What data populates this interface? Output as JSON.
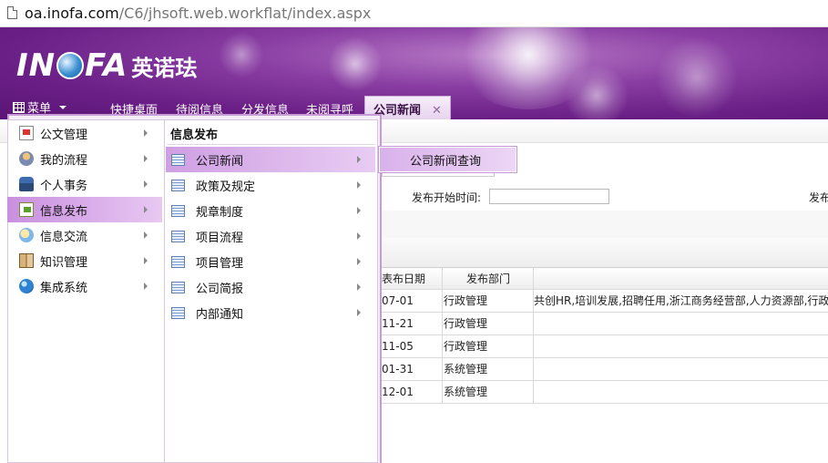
{
  "browser": {
    "url_host": "oa.inofa.com",
    "url_path": "/C6/jhsoft.web.workflat/index.aspx"
  },
  "header": {
    "logo_text_left": "IN",
    "logo_text_right": "FA",
    "logo_cn": "英诺珐",
    "menu_label": "菜单",
    "tabs": [
      {
        "label": "快捷桌面"
      },
      {
        "label": "待阅信息"
      },
      {
        "label": "分发信息"
      },
      {
        "label": "未阅寻呼"
      },
      {
        "label": "公司新闻",
        "close": "✕",
        "active": true
      }
    ]
  },
  "main_menu": {
    "items": [
      {
        "label": "公文管理",
        "icon": "document-icon"
      },
      {
        "label": "我的流程",
        "icon": "flow-icon"
      },
      {
        "label": "个人事务",
        "icon": "person-icon"
      },
      {
        "label": "信息发布",
        "icon": "publish-icon",
        "selected": true
      },
      {
        "label": "信息交流",
        "icon": "chat-icon"
      },
      {
        "label": "知识管理",
        "icon": "book-icon"
      },
      {
        "label": "集成系统",
        "icon": "globe-icon"
      }
    ]
  },
  "submenu": {
    "heading": "信息发布",
    "items": [
      {
        "label": "公司新闻",
        "selected": true
      },
      {
        "label": "政策及规定"
      },
      {
        "label": "规章制度"
      },
      {
        "label": "项目流程"
      },
      {
        "label": "项目管理"
      },
      {
        "label": "公司简报"
      },
      {
        "label": "内部通知"
      }
    ]
  },
  "submenu3": {
    "items": [
      {
        "label": "公司新闻查询"
      }
    ]
  },
  "background_page": {
    "publish_start_label": "发布开始时间:",
    "right_label_fragment": "发布",
    "table": {
      "headers": [
        "发布日期",
        "发布部门",
        ""
      ],
      "header_visible": [
        "表布日期",
        "发布部门",
        ""
      ],
      "rows": [
        [
          "07-01",
          "行政管理",
          "共创HR,培训发展,招聘任用,浙江商务经营部,人力资源部,行政"
        ],
        [
          "11-21",
          "行政管理",
          ""
        ],
        [
          "11-05",
          "行政管理",
          ""
        ],
        [
          "01-31",
          "系统管理",
          ""
        ],
        [
          "12-01",
          "系统管理",
          ""
        ]
      ]
    }
  },
  "colors": {
    "banner": "#6a1f86",
    "menu_highlight": "#c98fe0",
    "menu_border": "#c79cd6"
  }
}
